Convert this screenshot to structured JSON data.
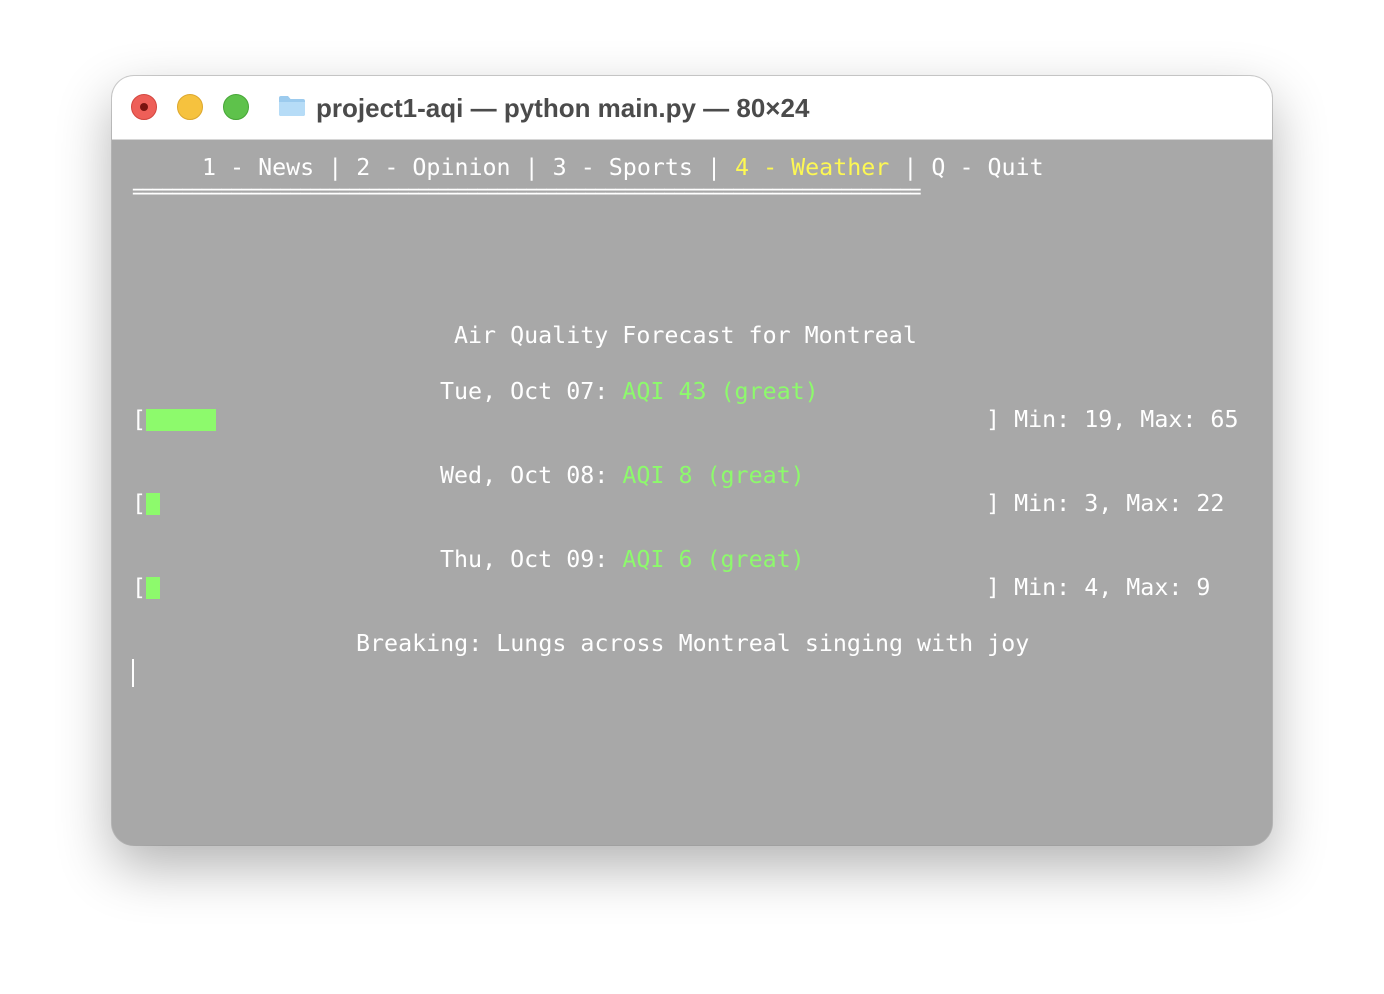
{
  "window": {
    "title": "project1-aqi — python main.py — 80×24",
    "traffic_lights": {
      "close": "#ee5f58",
      "minimize": "#f6c23e",
      "zoom": "#5ec24b"
    },
    "folder_icon": "folder-icon"
  },
  "colors": {
    "terminal_bg": "#a8a8a8",
    "text": "#ffffff",
    "active_menu": "#fdf853",
    "aqi_good": "#8dfa6c"
  },
  "menu": {
    "items": [
      {
        "label": "1 - News"
      },
      {
        "label": "2 - Opinion"
      },
      {
        "label": "3 - Sports"
      },
      {
        "label": "4 - Weather",
        "active": true
      },
      {
        "label": "Q - Quit"
      }
    ],
    "separator": " | ",
    "rule": "================================================================================"
  },
  "forecast": {
    "title": "Air Quality Forecast for Montreal",
    "bar_open": "[",
    "bar_close": "]",
    "aqi_scale_max": 500,
    "days": [
      {
        "date": "Tue, Oct 07:",
        "aqi_text": "AQI 43 (great)",
        "aqi": 43,
        "range": "Min: 19, Max: 65"
      },
      {
        "date": "Wed, Oct 08:",
        "aqi_text": "AQI 8 (great)",
        "aqi": 8,
        "range": "Min: 3, Max: 22"
      },
      {
        "date": "Thu, Oct 09:",
        "aqi_text": "AQI 6 (great)",
        "aqi": 6,
        "range": "Min: 4, Max: 9"
      }
    ],
    "headline": "Breaking: Lungs across Montreal singing with joy"
  }
}
